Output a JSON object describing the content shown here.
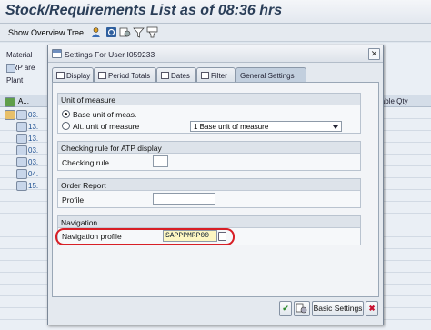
{
  "screen": {
    "title": "Stock/Requirements List as of 08:36 hrs",
    "toolbar_label": "Show Overview Tree",
    "bg_fields": [
      "Material",
      "MRP are",
      "Plant"
    ],
    "grid_col_a": "A...",
    "grid_rows": [
      "03.",
      "13.",
      "13.",
      "03.",
      "03.",
      "04.",
      "15."
    ],
    "avail_col": "lable Qty"
  },
  "dialog": {
    "title": "Settings For User I059233",
    "tabs": [
      {
        "label": "Display",
        "icon": "display-icon"
      },
      {
        "label": "Period Totals",
        "icon": "period-totals-icon"
      },
      {
        "label": "Dates",
        "icon": "calendar-icon"
      },
      {
        "label": "Filter",
        "icon": "filter-icon"
      },
      {
        "label": "General Settings",
        "icon": ""
      }
    ],
    "active_tab": "General Settings",
    "groups": {
      "uom": {
        "title": "Unit of measure",
        "opt_base": "Base unit of meas.",
        "opt_alt": "Alt. unit of measure",
        "alt_value": "1 Base unit of measure",
        "selected": "Base unit of meas."
      },
      "atp": {
        "title": "Checking rule for ATP display",
        "label": "Checking rule",
        "value": ""
      },
      "order": {
        "title": "Order Report",
        "label": "Profile",
        "value": ""
      },
      "nav": {
        "title": "Navigation",
        "label": "Navigation profile",
        "value": "SAPPPMRP00"
      }
    },
    "buttons": {
      "confirm": "✔",
      "basic_settings": "Basic Settings",
      "cancel": "✖"
    },
    "colors": {
      "highlight_ring": "#d81f26",
      "confirm_green": "#2e8b2e",
      "cancel_red": "#c8102e"
    }
  }
}
